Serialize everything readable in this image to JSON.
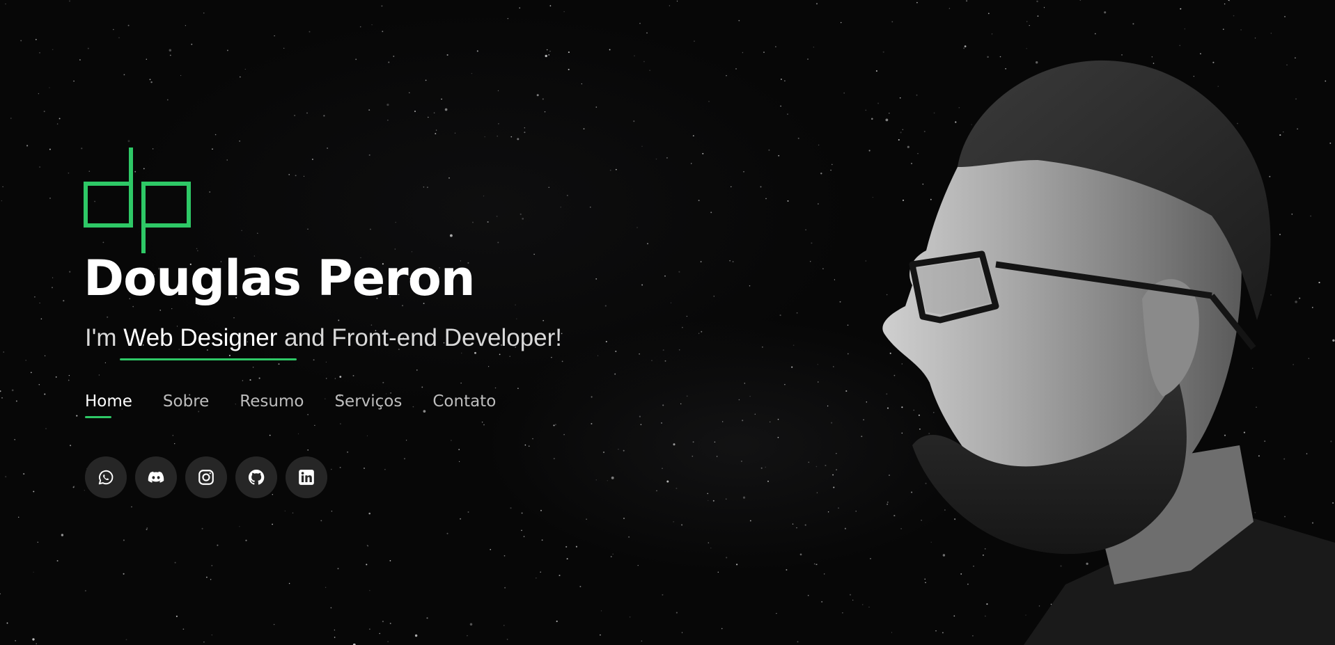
{
  "hero": {
    "name": "Douglas Peron",
    "tagline_prefix": "I'm ",
    "tagline_role": "Web Designer",
    "tagline_suffix": " and Front-end Developer!"
  },
  "nav": {
    "items": [
      {
        "label": "Home",
        "active": true
      },
      {
        "label": "Sobre",
        "active": false
      },
      {
        "label": "Resumo",
        "active": false
      },
      {
        "label": "Serviços",
        "active": false
      },
      {
        "label": "Contato",
        "active": false
      }
    ]
  },
  "socials": [
    {
      "icon": "whatsapp-icon"
    },
    {
      "icon": "discord-icon"
    },
    {
      "icon": "instagram-icon"
    },
    {
      "icon": "github-icon"
    },
    {
      "icon": "linkedin-icon"
    }
  ],
  "colors": {
    "accent": "#2ec866",
    "background": "#070707",
    "text": "#ffffff",
    "muted_text": "#bdbdbd",
    "social_bg": "#262626"
  }
}
